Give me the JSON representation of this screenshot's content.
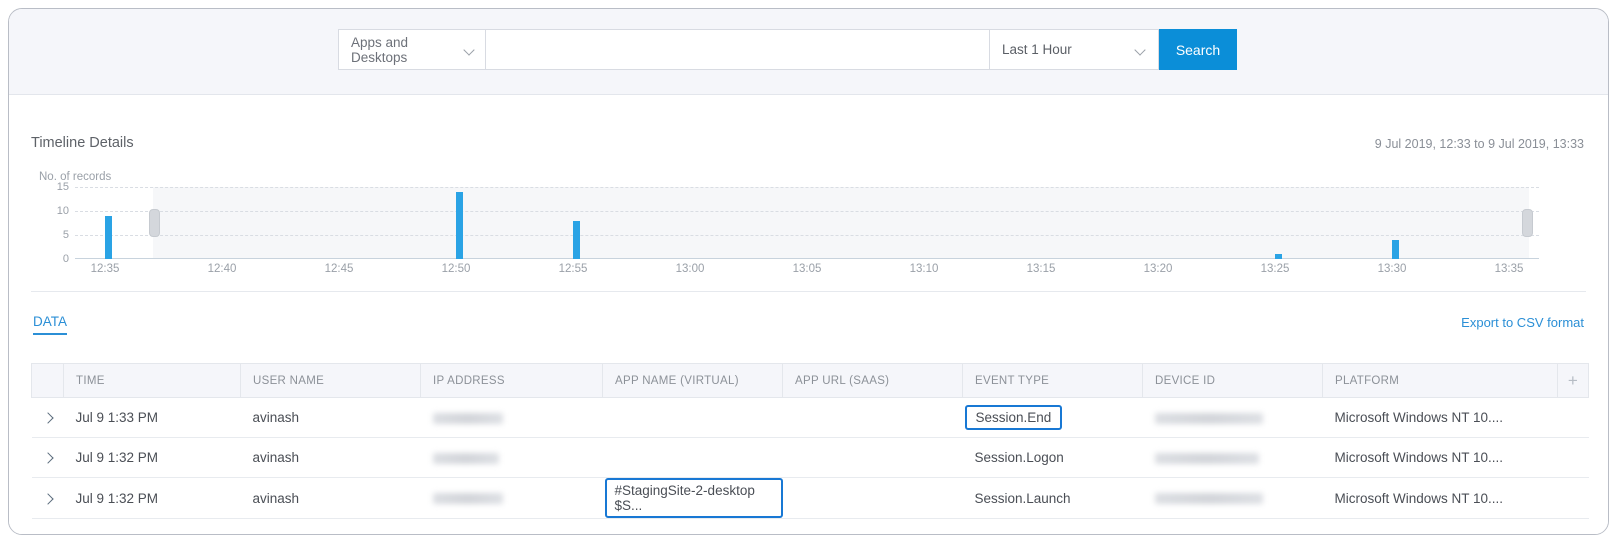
{
  "search": {
    "category_label": "Apps and Desktops",
    "query_value": "",
    "query_placeholder": "",
    "time_range_label": "Last 1 Hour",
    "search_button": "Search"
  },
  "timeline": {
    "title": "Timeline Details",
    "range_text": "9 Jul 2019, 12:33 to 9 Jul 2019, 13:33"
  },
  "data_section": {
    "tab_label": "DATA",
    "export_label": "Export to CSV format",
    "add_column_label": "+"
  },
  "table": {
    "columns": [
      "TIME",
      "USER NAME",
      "IP ADDRESS",
      "APP NAME (VIRTUAL)",
      "APP URL (SAAS)",
      "EVENT TYPE",
      "DEVICE ID",
      "PLATFORM"
    ],
    "rows": [
      {
        "time": "Jul 9 1:33 PM",
        "user_name": "avinash",
        "ip_address": "",
        "app_name": "",
        "app_url": "",
        "event_type": "Session.End",
        "device_id": "",
        "platform": "Microsoft Windows NT 10...."
      },
      {
        "time": "Jul 9 1:32 PM",
        "user_name": "avinash",
        "ip_address": "",
        "app_name": "",
        "app_url": "",
        "event_type": "Session.Logon",
        "device_id": "",
        "platform": "Microsoft Windows NT 10...."
      },
      {
        "time": "Jul 9 1:32 PM",
        "user_name": "avinash",
        "ip_address": "",
        "app_name": "#StagingSite-2-desktop $S...",
        "app_url": "",
        "event_type": "Session.Launch",
        "device_id": "",
        "platform": "Microsoft Windows NT 10...."
      }
    ]
  },
  "colors": {
    "accent": "#0b8ed8",
    "bar": "#2aa3e5",
    "highlight_box": "#1878d4",
    "link": "#2b8fd6"
  },
  "chart_data": {
    "type": "bar",
    "title": "Timeline Details",
    "xlabel": "",
    "ylabel": "No. of records",
    "ylim": [
      0,
      15
    ],
    "yticks": [
      0,
      5,
      10,
      15
    ],
    "grid": true,
    "legend": "none",
    "x": [
      "12:35",
      "12:40",
      "12:45",
      "12:50",
      "12:55",
      "13:00",
      "13:05",
      "13:10",
      "13:15",
      "13:20",
      "13:25",
      "13:30",
      "13:35"
    ],
    "categories": [
      "12:35",
      "12:40",
      "12:45",
      "12:50",
      "12:55",
      "13:00",
      "13:05",
      "13:10",
      "13:15",
      "13:20",
      "13:25",
      "13:30",
      "13:35"
    ],
    "values": [
      9,
      0,
      0,
      14,
      8,
      0,
      0,
      0,
      0,
      0,
      1,
      4,
      0
    ],
    "series": [
      {
        "name": "No. of records",
        "values": [
          9,
          0,
          0,
          14,
          8,
          0,
          0,
          0,
          0,
          0,
          1,
          4,
          0
        ]
      }
    ],
    "axis_range_text": "9 Jul 2019, 12:33 to 9 Jul 2019, 13:33"
  }
}
